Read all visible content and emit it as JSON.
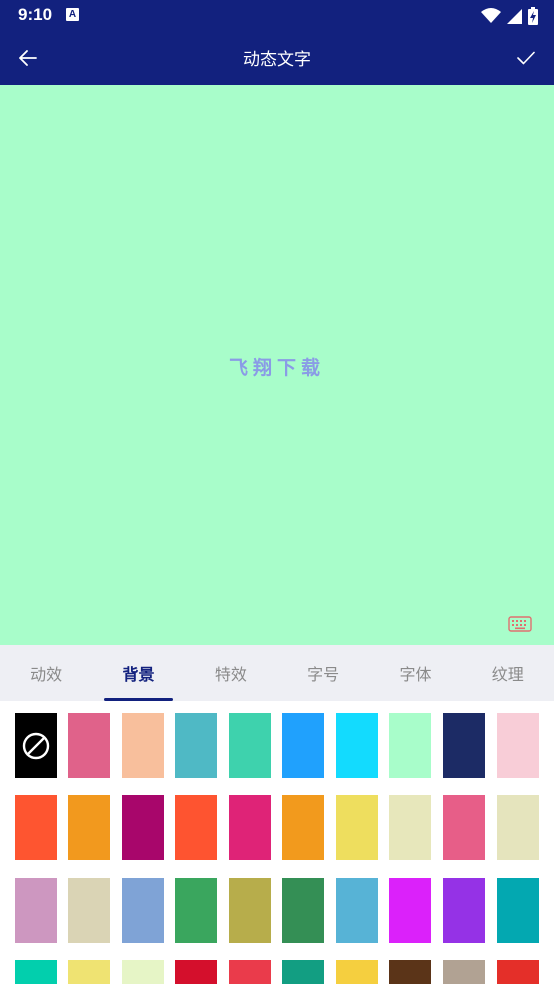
{
  "status_bar": {
    "time": "9:10",
    "notification_icon": "a-icon",
    "notification_letter": "A",
    "right_icons": [
      "wifi-icon",
      "signal-icon",
      "battery-charging-icon"
    ]
  },
  "app_bar": {
    "title": "动态文字",
    "back_icon": "arrow-left-icon",
    "confirm_icon": "check-icon"
  },
  "preview": {
    "text": "飞翔下载",
    "text_color": "#8a9be6",
    "background_color": "#a8fdca",
    "keyboard_icon": "keyboard-icon"
  },
  "tabs": {
    "items": [
      "动效",
      "背景",
      "特效",
      "字号",
      "字体",
      "纹理"
    ],
    "selected": "背景"
  },
  "palette": {
    "none_option_icon": "no-color-icon",
    "rows": [
      [
        "none",
        "#e0628a",
        "#f8bf9c",
        "#4fb9c5",
        "#3ed2ad",
        "#20a1fd",
        "#13dbfe",
        "#a8fdca",
        "#1c2b65",
        "#f8cdd7"
      ],
      [
        "#fe5530",
        "#f2991e",
        "#a8066b",
        "#fe5430",
        "#df2377",
        "#f29a1d",
        "#eede5e",
        "#e7e7bb",
        "#e75e88",
        "#e5e4bd"
      ],
      [
        "#cd97c0",
        "#dad4b5",
        "#7fa3d6",
        "#3aa65e",
        "#b7ad4b",
        "#348f55",
        "#57b3d6",
        "#db21fa",
        "#9532e6",
        "#03a8b1"
      ],
      [
        "#02cfad",
        "#efe372",
        "#e6f5c6",
        "#d40f2c",
        "#ea3b4b",
        "#129e82",
        "#f5cf3f",
        "#5b3418",
        "#b1a293",
        "#e42f29"
      ]
    ]
  },
  "colors": {
    "primary": "#12217e",
    "tab_bar_bg": "#eeeff4",
    "tab_inactive": "#8a8a8a"
  }
}
